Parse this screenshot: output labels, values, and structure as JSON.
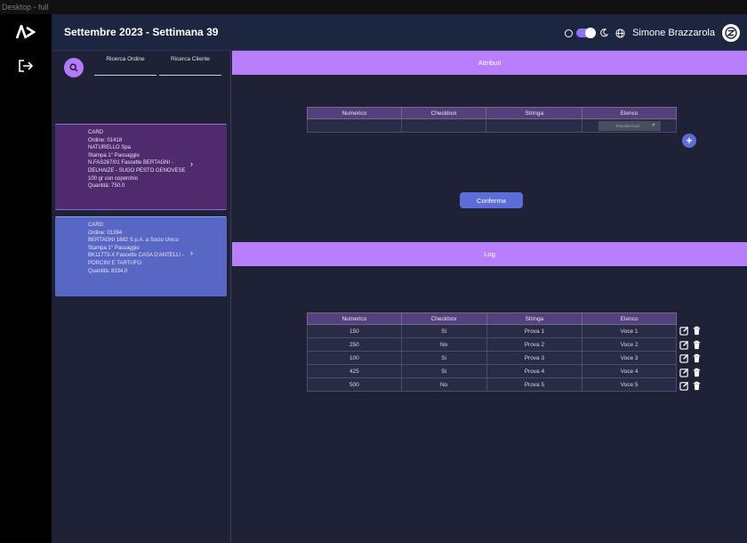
{
  "frame_label": "Desktop - full",
  "header": {
    "title": "Settembre 2023 - Settimana 39",
    "user_name": "Simone Brazzarola"
  },
  "icons": {
    "logo": "logo-icon",
    "logout": "logout-icon",
    "theme_toggle": "theme-toggle",
    "moon": "moon-icon",
    "globe": "globe-icon",
    "avatar": "avatar-icon",
    "search": "search-icon",
    "add": "plus-icon",
    "edit": "edit-icon",
    "delete": "trash-icon"
  },
  "colors": {
    "accent": "#b77ffb",
    "button": "#5b6ed8",
    "card_selected": "#4f2b6e",
    "card_secondary": "#5866c4",
    "header_bg": "#1d2640"
  },
  "search": {
    "order_label": "Ricerca Ordine",
    "customer_label": "Ricerca Cliente"
  },
  "cards": [
    {
      "heading": "CARD",
      "lines": [
        "Ordine: 01418",
        "NATURELLO Spa",
        "Stampa 1° Passaggio",
        "N.FAS267/01 Fascette BERTAGNI -",
        "DELHAIZE - SUGO PESTO GENOVESE",
        "100 gr con coperchio",
        "Quantità: 750.0"
      ]
    },
    {
      "heading": "CARD",
      "lines": [
        "Ordine: 01394",
        "BERTAGNI 1882 S.p.A. a Socio Unico",
        "Stampa 1° Passaggio",
        "BK11773-X Fascette CASA D'ANTELLI -",
        "PORCINI E TARTUFO",
        "Quantità: 8334.0"
      ]
    }
  ],
  "attributes": {
    "title": "Attributi",
    "columns": [
      "Numerico",
      "Checkbox",
      "Stringa",
      "Elenco"
    ],
    "select_value": "Favorite food",
    "confirm_label": "Conferma"
  },
  "log": {
    "title": "Log",
    "columns": [
      "Numerico",
      "Checkbox",
      "Stringa",
      "Elenco"
    ],
    "rows": [
      [
        "150",
        "Si",
        "Prova 1",
        "Voce 1"
      ],
      [
        "250",
        "No",
        "Prova 2",
        "Voce 2"
      ],
      [
        "100",
        "Si",
        "Prova 3",
        "Voce 3"
      ],
      [
        "425",
        "Si",
        "Prova 4",
        "Voce 4"
      ],
      [
        "500",
        "No",
        "Prova 5",
        "Voce 5"
      ]
    ]
  }
}
